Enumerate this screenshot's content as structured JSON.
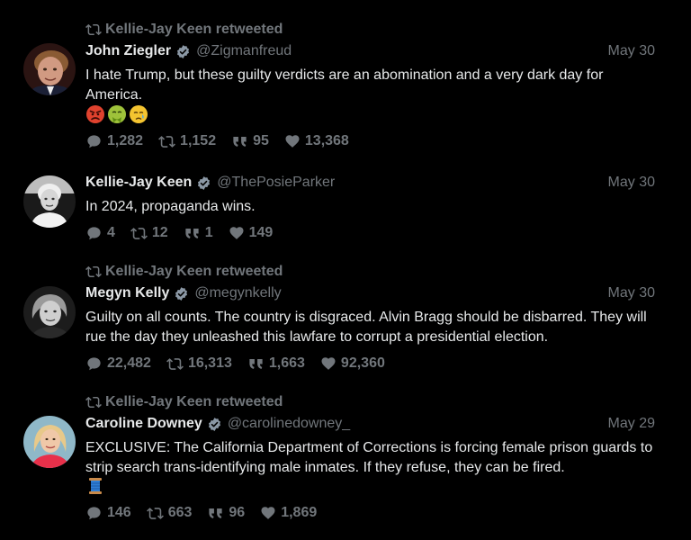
{
  "tweets": [
    {
      "retweeted_by": "Kellie-Jay Keen retweeted",
      "name": "John Ziegler",
      "handle": "@Zigmanfreud",
      "date": "May 30",
      "text": "I hate Trump, but these guilty verdicts are an abomination and a very dark day for America.",
      "emojis": [
        "angry-face-emoji",
        "nauseated-face-emoji",
        "crying-face-emoji"
      ],
      "replies": "1,282",
      "retweets": "1,152",
      "quotes": "95",
      "likes": "13,368"
    },
    {
      "retweeted_by": "",
      "name": "Kellie-Jay Keen",
      "handle": "@ThePosieParker",
      "date": "May 30",
      "text": "In 2024, propaganda wins.",
      "replies": "4",
      "retweets": "12",
      "quotes": "1",
      "likes": "149"
    },
    {
      "retweeted_by": "Kellie-Jay Keen retweeted",
      "name": "Megyn Kelly",
      "handle": "@megynkelly",
      "date": "May 30",
      "text": "Guilty on all counts. The country is disgraced. Alvin Bragg should be disbarred. They will rue the day they unleashed this lawfare to corrupt a presidential election.",
      "replies": "22,482",
      "retweets": "16,313",
      "quotes": "1,663",
      "likes": "92,360"
    },
    {
      "retweeted_by": "Kellie-Jay Keen retweeted",
      "name": "Caroline Downey",
      "handle": "@carolinedowney_",
      "date": "May 29",
      "text": "EXCLUSIVE: The California Department of Corrections is forcing female prison guards to strip search trans-identifying male inmates. If they refuse, they can be fired.",
      "emojis": [
        "spool-of-thread-emoji"
      ],
      "replies": "146",
      "retweets": "663",
      "quotes": "96",
      "likes": "1,869"
    }
  ],
  "colors": {
    "background": "#000000",
    "primary_text": "#e7e9ea",
    "secondary_text": "#71767b",
    "verified_badge": "#8b98a5"
  }
}
